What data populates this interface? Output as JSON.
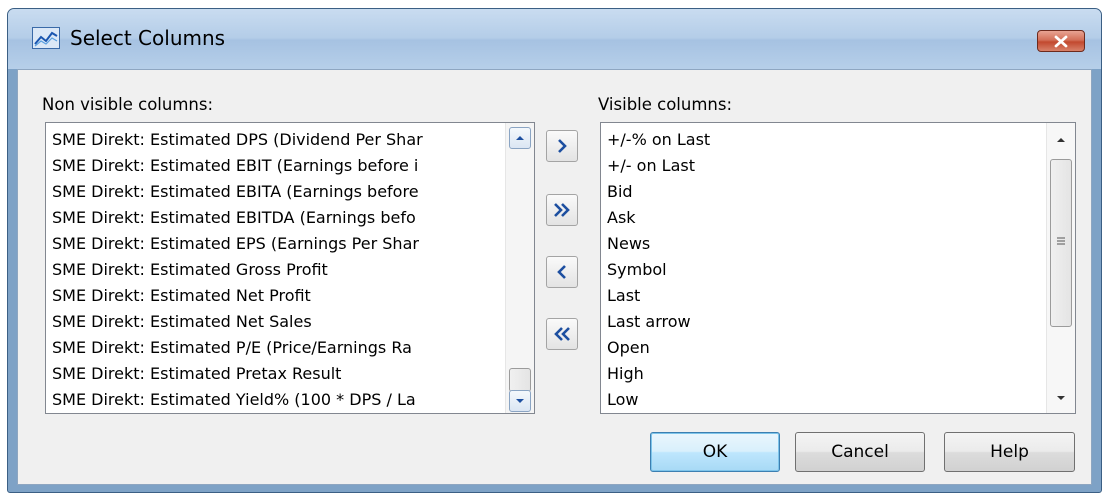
{
  "window": {
    "title": "Select Columns",
    "icon": "chart-line-icon",
    "close_icon": "close-icon"
  },
  "non_visible": {
    "label": "Non visible columns:",
    "items": [
      "SME Direkt: Estimated DPS (Dividend Per Shar",
      "SME Direkt: Estimated EBIT (Earnings before i",
      "SME Direkt: Estimated EBITA (Earnings before",
      "SME Direkt: Estimated EBITDA (Earnings befo",
      "SME Direkt: Estimated EPS (Earnings Per Shar",
      "SME Direkt: Estimated Gross Profit",
      "SME Direkt: Estimated Net Profit",
      "SME Direkt: Estimated Net Sales",
      "SME Direkt: Estimated P/E (Price/Earnings Ra",
      "SME Direkt: Estimated Pretax Result",
      "SME Direkt: Estimated Yield% (100 * DPS / La"
    ],
    "scroll_position": 0.95
  },
  "visible": {
    "label": "Visible columns:",
    "items": [
      "+/-% on Last",
      "+/- on Last",
      "Bid",
      "Ask",
      "News",
      "Symbol",
      "Last",
      "Last arrow",
      "Open",
      "High",
      "Low"
    ],
    "scroll_position": 0.0
  },
  "move_buttons": {
    "add_one": ">",
    "add_all": "»",
    "remove_one": "<",
    "remove_all": "«"
  },
  "buttons": {
    "ok": "OK",
    "cancel": "Cancel",
    "help": "Help"
  },
  "colors": {
    "arrow_blue": "#1d4fa0",
    "frame": "#7ea2c6",
    "close_red": "#c2492f"
  }
}
